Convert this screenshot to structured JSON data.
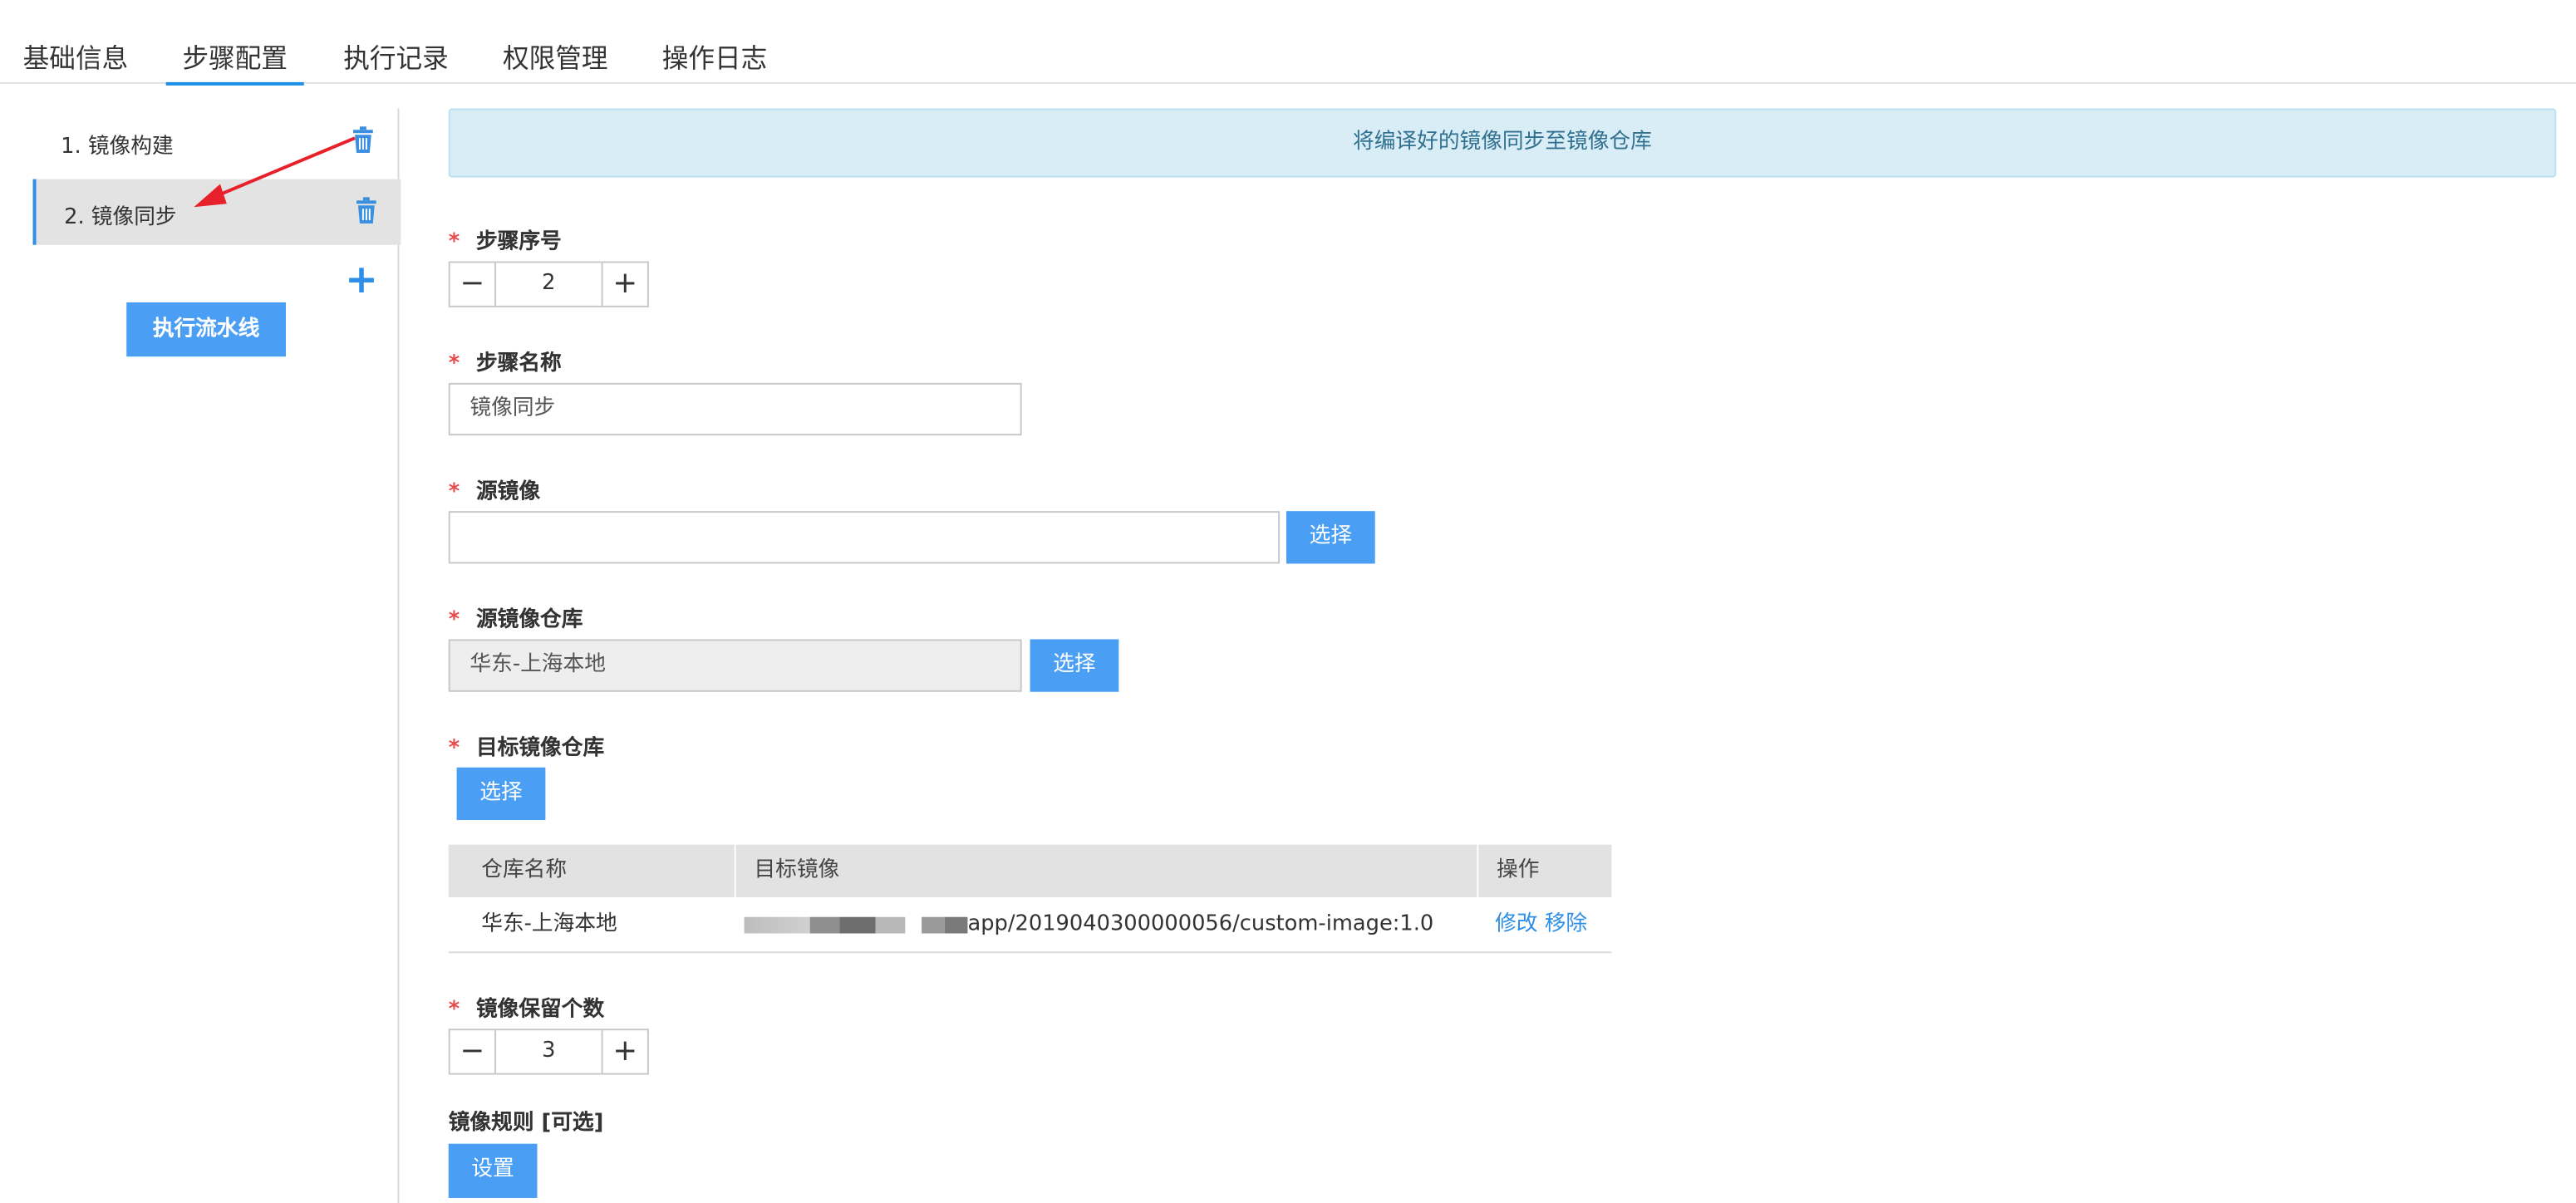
{
  "tabs": [
    "基础信息",
    "步骤配置",
    "执行记录",
    "权限管理",
    "操作日志"
  ],
  "sidebar": {
    "steps": [
      {
        "label": "1. 镜像构建",
        "icon": "trash-icon"
      },
      {
        "label": "2. 镜像同步",
        "icon": "trash-icon"
      }
    ],
    "add_icon": "plus-icon",
    "run_button": "执行流水线"
  },
  "banner": "将编译好的镜像同步至镜像仓库",
  "form": {
    "required_mark": "*",
    "step_order": {
      "label": "步骤序号",
      "value": "2",
      "minus": "−",
      "plus": "+"
    },
    "step_name": {
      "label": "步骤名称",
      "value": "镜像同步"
    },
    "source_image": {
      "label": "源镜像",
      "value": "",
      "button": "选择"
    },
    "source_repo": {
      "label": "源镜像仓库",
      "value": "华东-上海本地",
      "button": "选择"
    },
    "target_repo": {
      "label": "目标镜像仓库",
      "button": "选择",
      "table": {
        "headers": [
          "仓库名称",
          "目标镜像",
          "操作"
        ],
        "rows": [
          {
            "repo": "华东-上海本地",
            "image": "app/2019040300000056/custom-image:1.0",
            "edit": "修改",
            "remove": "移除"
          }
        ]
      }
    },
    "retain_count": {
      "label": "镜像保留个数",
      "value": "3",
      "minus": "−",
      "plus": "+"
    },
    "image_rule": {
      "label": "镜像规则 [可选]",
      "button": "设置"
    }
  },
  "colors": {
    "accent": "#4a9ff5",
    "required": "#e64a4a",
    "banner_bg": "#d9edf7",
    "annotation_arrow": "#e8202a"
  }
}
